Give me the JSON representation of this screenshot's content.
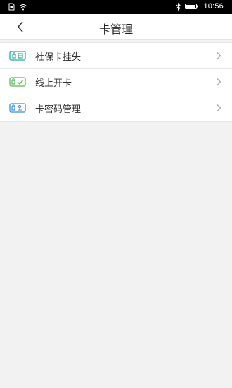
{
  "status_bar": {
    "time": "10:56",
    "icons": [
      "sim-icon",
      "wifi-icon",
      "bluetooth-icon",
      "battery-icon"
    ]
  },
  "nav": {
    "title": "卡管理",
    "back_icon": "chevron-left-icon"
  },
  "menu": {
    "items": [
      {
        "label": "社保卡挂失",
        "icon": "card-lock-icon",
        "color": "#2ea6a0"
      },
      {
        "label": "线上开卡",
        "icon": "card-check-icon",
        "color": "#5cb85c"
      },
      {
        "label": "卡密码管理",
        "icon": "card-key-icon",
        "color": "#3a8fd6"
      }
    ],
    "chevron_icon": "chevron-right-icon"
  }
}
